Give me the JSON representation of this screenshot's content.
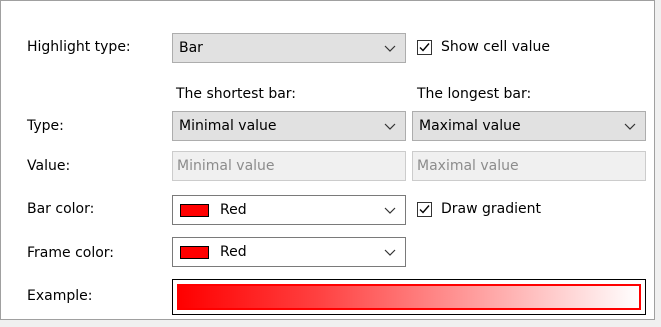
{
  "highlight_type": {
    "label": "Highlight type:",
    "value": "Bar"
  },
  "show_cell_value": {
    "label": "Show cell value",
    "checked": true
  },
  "columns": {
    "shortest": "The shortest bar:",
    "longest": "The longest bar:"
  },
  "type_row": {
    "label": "Type:",
    "shortest_value": "Minimal value",
    "longest_value": "Maximal value"
  },
  "value_row": {
    "label": "Value:",
    "shortest_placeholder": "Minimal value",
    "longest_placeholder": "Maximal value"
  },
  "bar_color": {
    "label": "Bar color:",
    "value": "Red",
    "color": "#ff0000"
  },
  "draw_gradient": {
    "label": "Draw gradient",
    "checked": true
  },
  "frame_color": {
    "label": "Frame color:",
    "value": "Red",
    "color": "#ff0000"
  },
  "example": {
    "label": "Example:"
  }
}
